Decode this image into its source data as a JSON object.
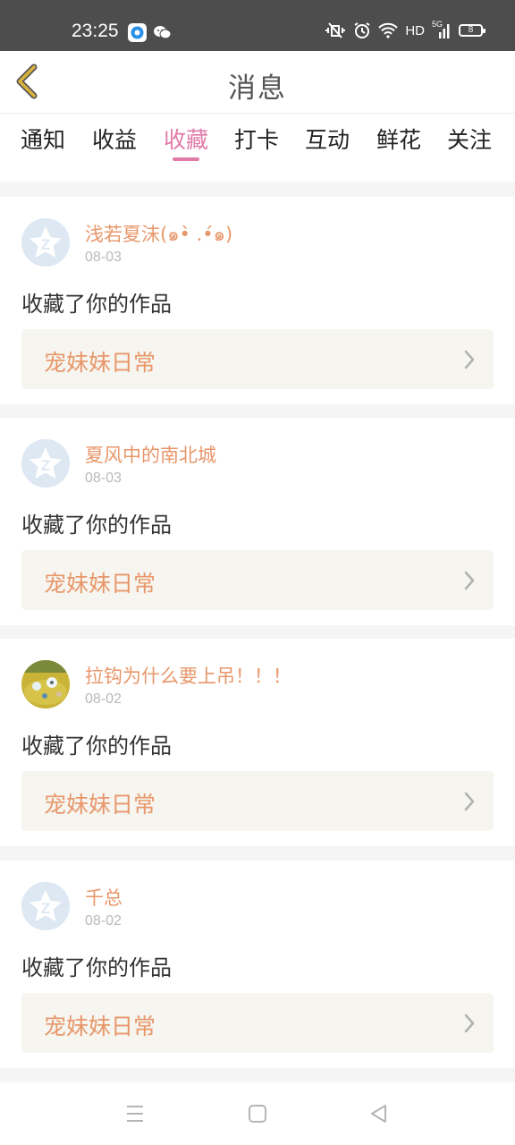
{
  "status_bar": {
    "time": "23:25",
    "left_icons": [
      "app-icon",
      "wechat-icon"
    ],
    "right_icons": [
      "vibrate-icon",
      "alarm-icon",
      "wifi-icon"
    ],
    "hd": "HD",
    "network": "5G",
    "battery": "8"
  },
  "header": {
    "title": "消息",
    "back_icon": "chevron-left-icon",
    "accent_color": "#c9a227"
  },
  "tabs": [
    {
      "label": "通知",
      "active": false
    },
    {
      "label": "收益",
      "active": false
    },
    {
      "label": "收藏",
      "active": true
    },
    {
      "label": "打卡",
      "active": false
    },
    {
      "label": "互动",
      "active": false
    },
    {
      "label": "鲜花",
      "active": false
    },
    {
      "label": "关注",
      "active": false
    }
  ],
  "colors": {
    "active_tab": "#e17aa8",
    "nickname": "#e8976b",
    "work_box": "#f6f5ef"
  },
  "messages": [
    {
      "user": "浅若夏沫(๑•̀ .•́๑)",
      "date": "08-03",
      "action": "收藏了你的作品",
      "work": "宠妹妹日常",
      "avatar": "default-qzone-avatar"
    },
    {
      "user": "夏风中的南北城",
      "date": "08-03",
      "action": "收藏了你的作品",
      "work": "宠妹妹日常",
      "avatar": "default-qzone-avatar"
    },
    {
      "user": "拉钩为什么要上吊！！！",
      "date": "08-02",
      "action": "收藏了你的作品",
      "work": "宠妹妹日常",
      "avatar": "photo-avatar"
    },
    {
      "user": "千总",
      "date": "08-02",
      "action": "收藏了你的作品",
      "work": "宠妹妹日常",
      "avatar": "default-qzone-avatar"
    }
  ],
  "navbar": {
    "icons": [
      "menu-icon",
      "home-icon",
      "back-triangle-icon"
    ]
  }
}
